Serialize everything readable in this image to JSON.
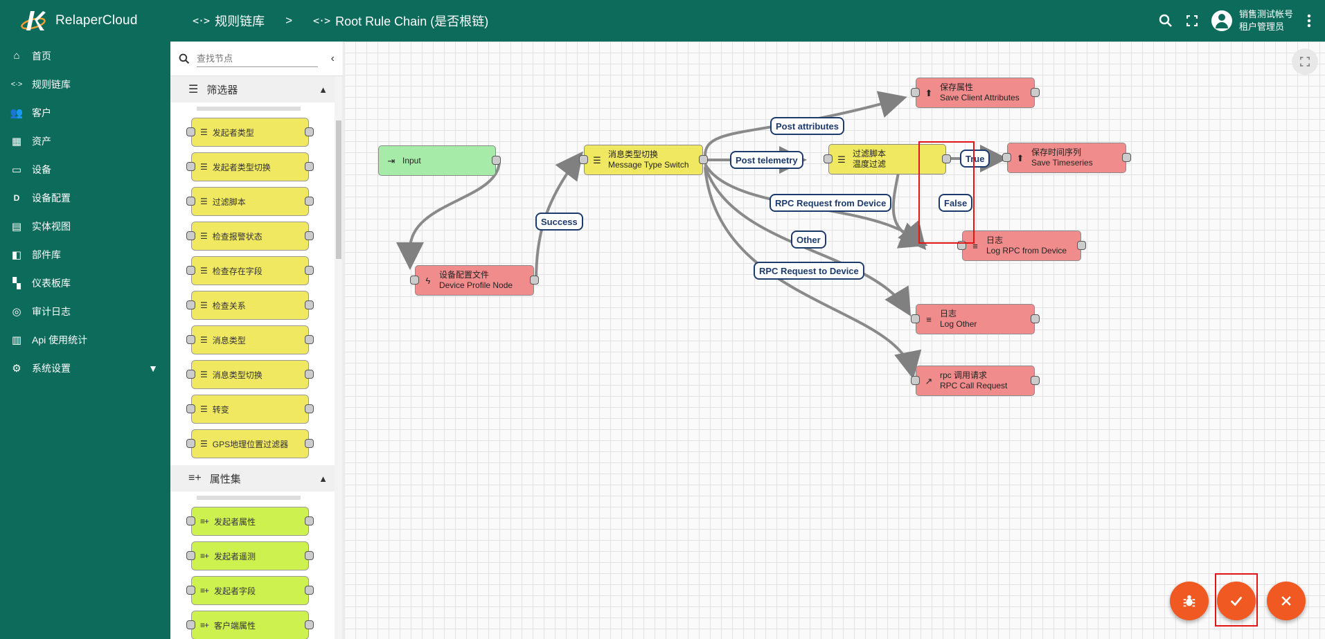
{
  "brand": {
    "name": "RelaperCloud"
  },
  "breadcrumb": [
    {
      "label": "规则链库"
    },
    {
      "label": "Root Rule Chain (是否根链)"
    }
  ],
  "breadcrumb_sep": ">",
  "user": {
    "name": "销售测试帐号",
    "role": "租户管理员"
  },
  "nav": [
    {
      "label": "首页",
      "icon": "home-icon"
    },
    {
      "label": "规则链库",
      "icon": "rule-chain-icon"
    },
    {
      "label": "客户",
      "icon": "customers-icon"
    },
    {
      "label": "资产",
      "icon": "assets-icon"
    },
    {
      "label": "设备",
      "icon": "devices-icon"
    },
    {
      "label": "设备配置",
      "icon": "device-profile-icon"
    },
    {
      "label": "实体视图",
      "icon": "entity-view-icon"
    },
    {
      "label": "部件库",
      "icon": "widgets-icon"
    },
    {
      "label": "仪表板库",
      "icon": "dashboards-icon"
    },
    {
      "label": "审计日志",
      "icon": "audit-log-icon"
    },
    {
      "label": "Api 使用统计",
      "icon": "api-usage-icon"
    },
    {
      "label": "系统设置",
      "icon": "settings-icon"
    }
  ],
  "library": {
    "search_placeholder": "查找节点",
    "sections": [
      {
        "title": "筛选器",
        "nodes": [
          "发起者类型",
          "发起者类型切换",
          "过滤脚本",
          "检查报警状态",
          "检查存在字段",
          "检查关系",
          "消息类型",
          "消息类型切换",
          "转变",
          "GPS地理位置过滤器"
        ]
      },
      {
        "title": "属性集",
        "nodes": [
          "发起者属性",
          "发起者遥测",
          "发起者字段",
          "客户端属性"
        ]
      }
    ]
  },
  "canvas": {
    "nodes": {
      "input": {
        "title": "Input"
      },
      "device_profile": {
        "title": "设备配置文件",
        "subtitle": "Device Profile Node"
      },
      "msg_switch": {
        "title": "消息类型切换",
        "subtitle": "Message Type Switch"
      },
      "save_attr": {
        "title": "保存属性",
        "subtitle": "Save Client Attributes"
      },
      "filter_script": {
        "title": "过滤脚本",
        "subtitle": "温度过滤"
      },
      "save_ts": {
        "title": "保存时间序列",
        "subtitle": "Save Timeseries"
      },
      "log_rpc": {
        "title": "日志",
        "subtitle": "Log RPC from Device"
      },
      "log_other": {
        "title": "日志",
        "subtitle": "Log Other"
      },
      "rpc_call": {
        "title": "rpc 调用请求",
        "subtitle": "RPC Call Request"
      }
    },
    "labels": {
      "success": "Success",
      "post_attributes": "Post attributes",
      "post_telemetry": "Post telemetry",
      "rpc_from_device": "RPC Request from Device",
      "other": "Other",
      "rpc_to_device": "RPC Request to Device",
      "true": "True",
      "false": "False"
    }
  },
  "colors": {
    "primary": "#0d6b5c",
    "accent": "#f05a22",
    "edge_label": "#1c3a6b",
    "highlight": "#e41414"
  }
}
